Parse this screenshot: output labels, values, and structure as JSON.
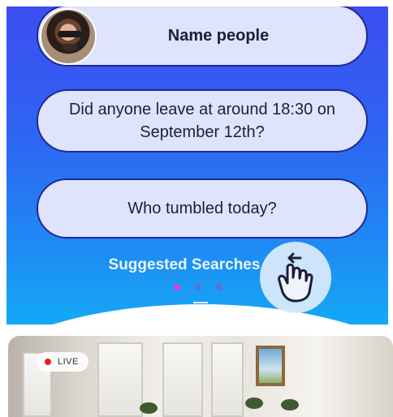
{
  "suggestions": [
    {
      "label": "Name people",
      "has_avatar": true
    },
    {
      "label": "Did anyone leave at around 18:30 on September 12th?"
    },
    {
      "label": "Who tumbled today?"
    }
  ],
  "suggested_searches": {
    "label": "Suggested Searches",
    "pagination": {
      "total": 3,
      "active": 1
    }
  },
  "gesture_icon": "swipe-left-hand-icon",
  "camera_preview": {
    "live_label": "LIVE",
    "live_indicator_color": "#e0251b"
  },
  "colors": {
    "gradient_top": "#3d4df0",
    "gradient_bottom": "#14a9f5",
    "pill_background": "#dfe3fb",
    "pill_border": "#1d2a8f",
    "active_dot": "#e040d0"
  }
}
